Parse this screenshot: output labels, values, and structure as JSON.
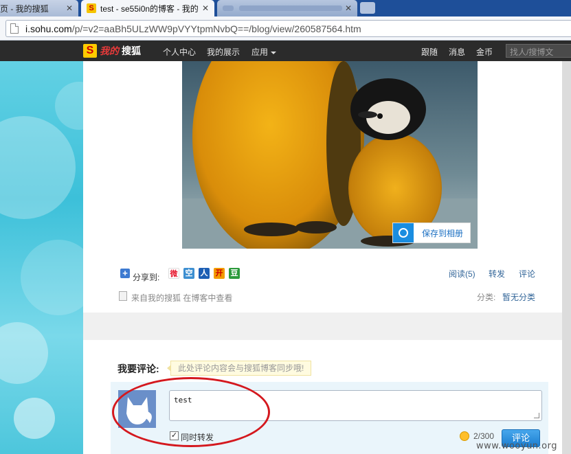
{
  "browser": {
    "tabs": [
      {
        "title": "页 - 我的搜狐",
        "active": false
      },
      {
        "title": "test - se55i0n的博客 - 我的",
        "active": true
      },
      {
        "title": "",
        "active": false
      }
    ],
    "url_host": "i.sohu.com",
    "url_path": "/p/=v2=aaBh5ULzWW9pVYYtpmNvbQ==/blog/view/260587564.htm"
  },
  "topnav": {
    "logo_text_red": "我的",
    "logo_text_white": "搜狐",
    "logo_letter": "S",
    "left_links": [
      "个人中心",
      "我的展示",
      "应用"
    ],
    "right_links": [
      "跟随",
      "消息",
      "金币"
    ],
    "search_placeholder": "找人/搜博文"
  },
  "photo": {
    "save_album_label": "保存到相册"
  },
  "share": {
    "label": "分享到:",
    "icons": [
      {
        "name": "weibo-icon",
        "glyph": "微",
        "color": "#e6162d"
      },
      {
        "name": "qzone-icon",
        "glyph": "空",
        "color": "#3d8fd1"
      },
      {
        "name": "renren-icon",
        "glyph": "人",
        "color": "#1d5fb4"
      },
      {
        "name": "kaixin-icon",
        "glyph": "开",
        "color": "#f29c00"
      },
      {
        "name": "douban-icon",
        "glyph": "豆",
        "color": "#2c9a3c"
      }
    ],
    "reads": "阅读(5)",
    "forward": "转发",
    "comment": "评论"
  },
  "source": {
    "text": "来自我的搜狐 在博客中查看",
    "category_label": "分类:",
    "category_value": "暂无分类"
  },
  "comment_form": {
    "title": "我要评论:",
    "hint": "此处评论内容会与搜狐博客同步哦!",
    "text": "test",
    "checkbox_label": "同时转发",
    "checkbox_checked": true,
    "counter": "2/300",
    "submit_label": "评论"
  },
  "watermark": "www.wooyun.org"
}
